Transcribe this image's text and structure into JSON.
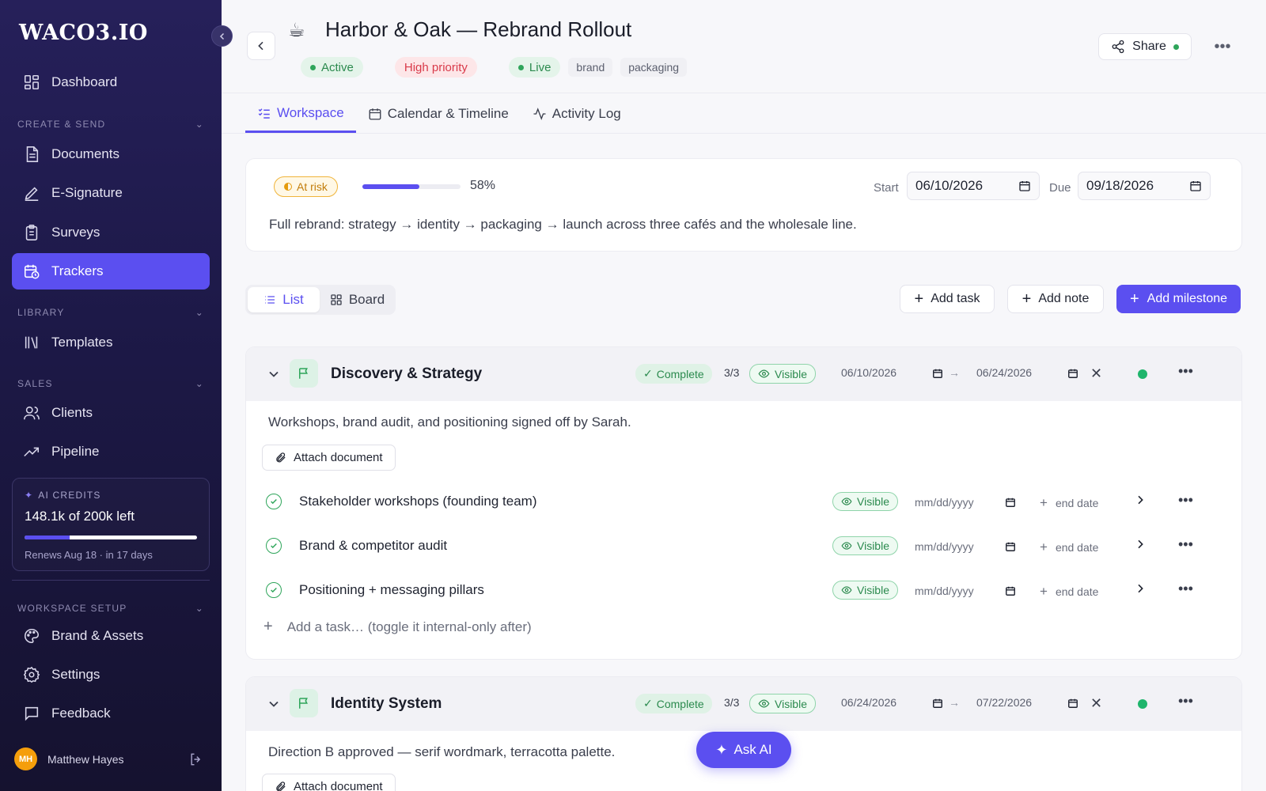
{
  "sidebar": {
    "logo": "WACO3.IO",
    "nav": {
      "dashboard": "Dashboard",
      "documents": "Documents",
      "esignature": "E-Signature",
      "surveys": "Surveys",
      "trackers": "Trackers",
      "templates": "Templates",
      "clients": "Clients",
      "pipeline": "Pipeline",
      "brand_assets": "Brand & Assets",
      "settings": "Settings",
      "feedback": "Feedback"
    },
    "sections": {
      "create_send": "CREATE & SEND",
      "library": "LIBRARY",
      "sales": "SALES",
      "workspace_setup": "WORKSPACE SETUP"
    },
    "credits": {
      "label": "AI CREDITS",
      "amount": "148.1k of 200k left",
      "used_fraction": 0.26,
      "renews": "Renews Aug 18 · in 17 days"
    },
    "user": {
      "initials": "MH",
      "name": "Matthew Hayes"
    }
  },
  "header": {
    "emoji": "☕",
    "title": "Harbor & Oak — Rebrand Rollout",
    "tags": {
      "status": "Active",
      "priority": "High priority",
      "live": "Live",
      "labels": [
        "brand",
        "packaging"
      ]
    },
    "share_label": "Share"
  },
  "tabs": {
    "workspace": "Workspace",
    "calendar": "Calendar & Timeline",
    "activity": "Activity Log"
  },
  "summary": {
    "risk": "At risk",
    "progress_pct": 58,
    "progress_text": "58%",
    "start_label": "Start",
    "start_date": "06/10/2026",
    "due_label": "Due",
    "due_date": "09/18/2026",
    "description": "Full rebrand: strategy → identity → packaging → launch across three cafés and the wholesale line."
  },
  "toolbar": {
    "list": "List",
    "board": "Board",
    "add_task": "Add task",
    "add_note": "Add note",
    "add_milestone": "Add milestone"
  },
  "milestones": [
    {
      "title": "Discovery & Strategy",
      "status": "Complete",
      "count": "3/3",
      "visibility": "Visible",
      "start": "06/10/2026",
      "end": "06/24/2026",
      "description": "Workshops, brand audit, and positioning signed off by Sarah.",
      "attach_label": "Attach document",
      "tasks": [
        {
          "title": "Stakeholder workshops (founding team)",
          "visibility": "Visible",
          "date_placeholder": "mm/dd/yyyy",
          "end_label": "end date"
        },
        {
          "title": "Brand & competitor audit",
          "visibility": "Visible",
          "date_placeholder": "mm/dd/yyyy",
          "end_label": "end date"
        },
        {
          "title": "Positioning + messaging pillars",
          "visibility": "Visible",
          "date_placeholder": "mm/dd/yyyy",
          "end_label": "end date"
        }
      ],
      "add_task_placeholder": "Add a task… (toggle it internal-only after)"
    },
    {
      "title": "Identity System",
      "status": "Complete",
      "count": "3/3",
      "visibility": "Visible",
      "start": "06/24/2026",
      "end": "07/22/2026",
      "description": "Direction B approved — serif wordmark, terracotta palette.",
      "attach_label": "Attach document"
    }
  ],
  "ask_ai": "Ask AI"
}
